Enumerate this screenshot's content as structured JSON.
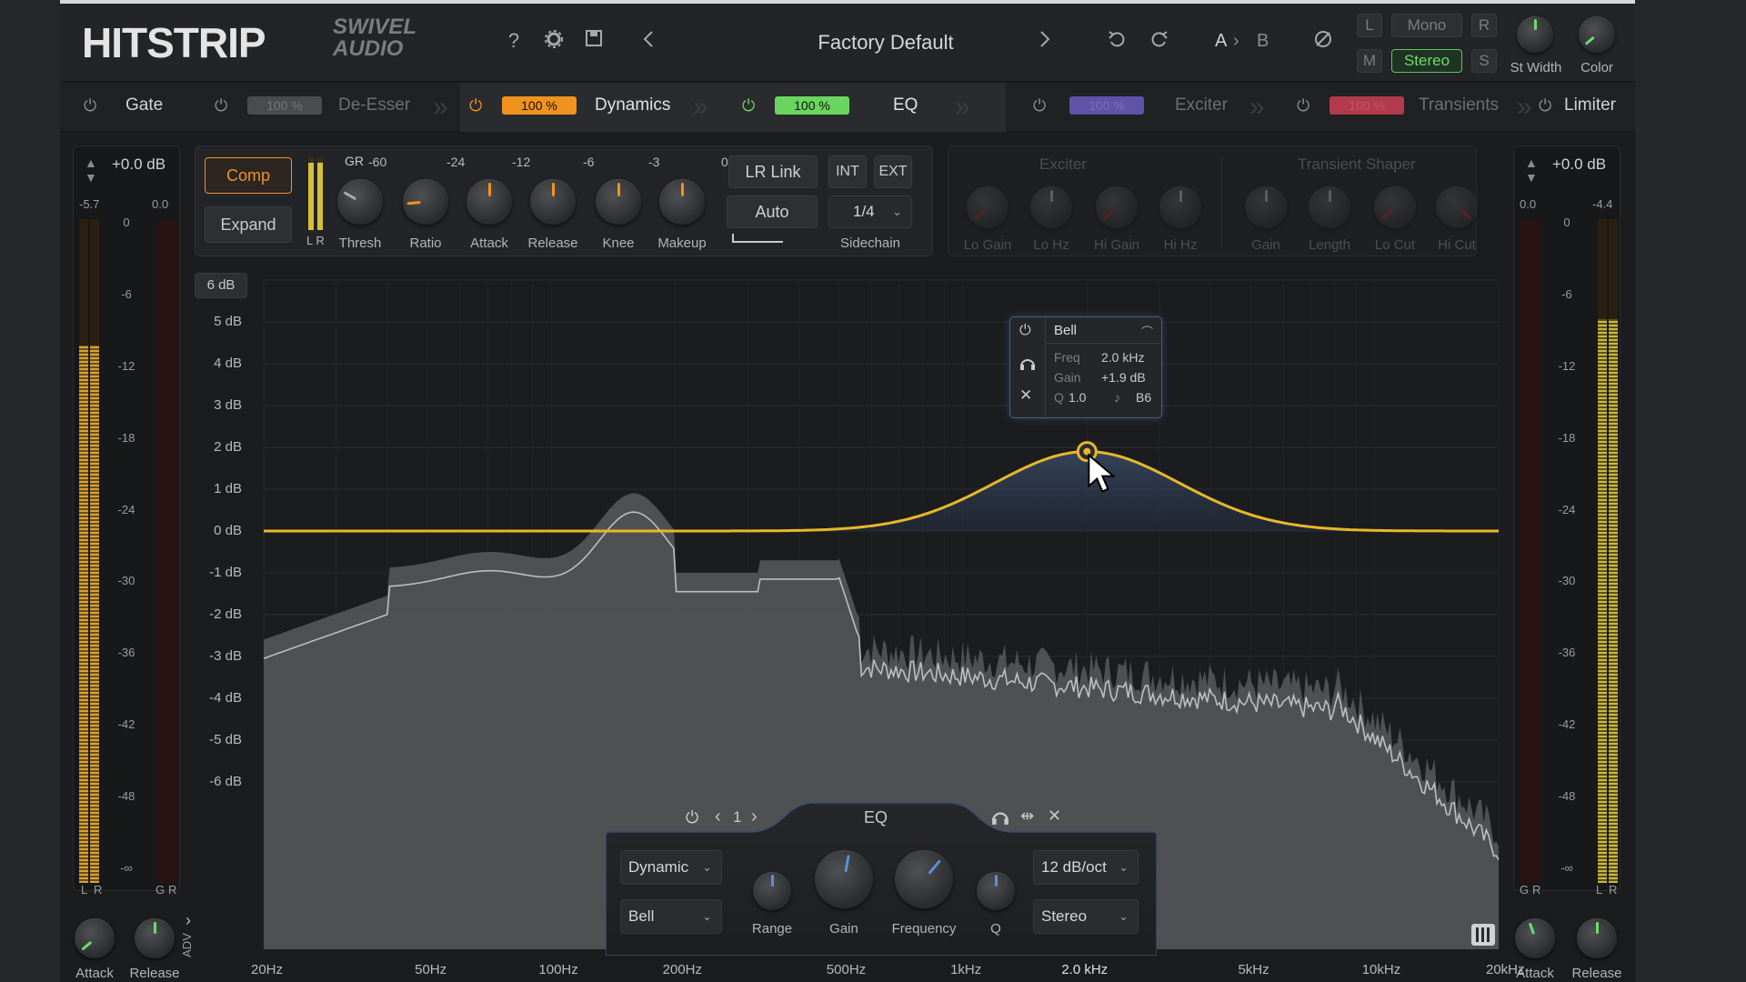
{
  "header": {
    "product_name": "HITSTRIP",
    "brand_name": "SWIVEL AUDIO",
    "icons": [
      "help-icon",
      "gear-icon",
      "save-icon",
      "chevron-left-icon",
      "chevron-right-icon",
      "undo-icon",
      "redo-icon",
      "phase-icon"
    ],
    "help_glyph": "?",
    "preset_name": "Factory Default",
    "ab_a": "A",
    "ab_b": "B",
    "channel": {
      "l": "L",
      "r": "R",
      "m": "M",
      "s": "S",
      "mono": "Mono",
      "stereo": "Stereo"
    },
    "st_width_label": "St Width",
    "color_label": "Color"
  },
  "tabs": [
    {
      "name": "Gate",
      "pct": ""
    },
    {
      "name": "De-Esser",
      "pct": "100 %",
      "color": "#6c6d70"
    },
    {
      "name": "Dynamics",
      "pct": "100 %",
      "color": "#f0921e"
    },
    {
      "name": "EQ",
      "pct": "100 %",
      "color": "#68d65e"
    },
    {
      "name": "Exciter",
      "pct": "100 %",
      "color": "#5f52a8"
    },
    {
      "name": "Transients",
      "pct": "100 %",
      "color": "#b23a4a"
    },
    {
      "name": "Limiter",
      "pct": ""
    }
  ],
  "left_meter": {
    "gain": "+0.0 dB",
    "peak_l": "-5.7",
    "peak_r": "0.0",
    "scale": [
      "0",
      "-6",
      "-12",
      "-18",
      "-24",
      "-30",
      "-36",
      "-42",
      "-48",
      "-∞"
    ],
    "label_l": "L",
    "label_r": "R",
    "label_g": "G",
    "label_gr": "R",
    "knobs": [
      "Attack",
      "Release"
    ],
    "adv": "ADV",
    "level": 0.81
  },
  "right_meter": {
    "gain": "+0.0 dB",
    "peak_l": "0.0",
    "peak_r": "-4.4",
    "scale": [
      "0",
      "-6",
      "-12",
      "-18",
      "-24",
      "-30",
      "-36",
      "-42",
      "-48",
      "-∞"
    ],
    "label_l": "L",
    "label_r": "R",
    "label_g": "G",
    "label_gr": "R",
    "knobs": [
      "Attack",
      "Release"
    ],
    "level": 0.85
  },
  "dynamics": {
    "comp": "Comp",
    "expand": "Expand",
    "gr": "GR",
    "gr_scale": [
      "-60",
      "-24",
      "-12",
      "-6",
      "-3",
      "0"
    ],
    "lr": "L  R",
    "knobs": [
      "Thresh",
      "Ratio",
      "Attack",
      "Release",
      "Knee",
      "Makeup"
    ],
    "lr_link": "LR Link",
    "int": "INT",
    "ext": "EXT",
    "auto": "Auto",
    "sidechain_value": "1/4",
    "sidechain_label": "Sidechain"
  },
  "exciter": {
    "title": "Exciter",
    "knobs": [
      "Lo Gain",
      "Lo Hz",
      "Hi Gain",
      "Hi Hz"
    ]
  },
  "transient": {
    "title": "Transient Shaper",
    "knobs": [
      "Gain",
      "Length",
      "Lo Cut",
      "Hi Cut"
    ]
  },
  "eq": {
    "range_button": "6 dB",
    "y_labels": [
      "5 dB",
      "4 dB",
      "3 dB",
      "2 dB",
      "1 dB",
      "0 dB",
      "-1 dB",
      "-2 dB",
      "-3 dB",
      "-4 dB",
      "-5 dB",
      "-6 dB"
    ],
    "x_labels": [
      "20Hz",
      "50Hz",
      "100Hz",
      "200Hz",
      "500Hz",
      "1kHz",
      "2.0 kHz",
      "5kHz",
      "10kHz",
      "20kHz"
    ],
    "curve_color": "#e8b82a",
    "band": {
      "type": "Bell",
      "freq_label": "Freq",
      "freq": "2.0 kHz",
      "gain_label": "Gain",
      "gain": "+1.9 dB",
      "q_label": "Q",
      "q": "1.0",
      "note": "B6",
      "freq_hz": 2000,
      "gain_db": 1.9,
      "q_value": 1.0
    }
  },
  "band_panel": {
    "band_number": "1",
    "title": "EQ",
    "mode": "Dynamic",
    "shape": "Bell",
    "slope": "12 dB/oct",
    "channel": "Stereo",
    "knobs": [
      "Range",
      "Gain",
      "Frequency",
      "Q"
    ]
  }
}
